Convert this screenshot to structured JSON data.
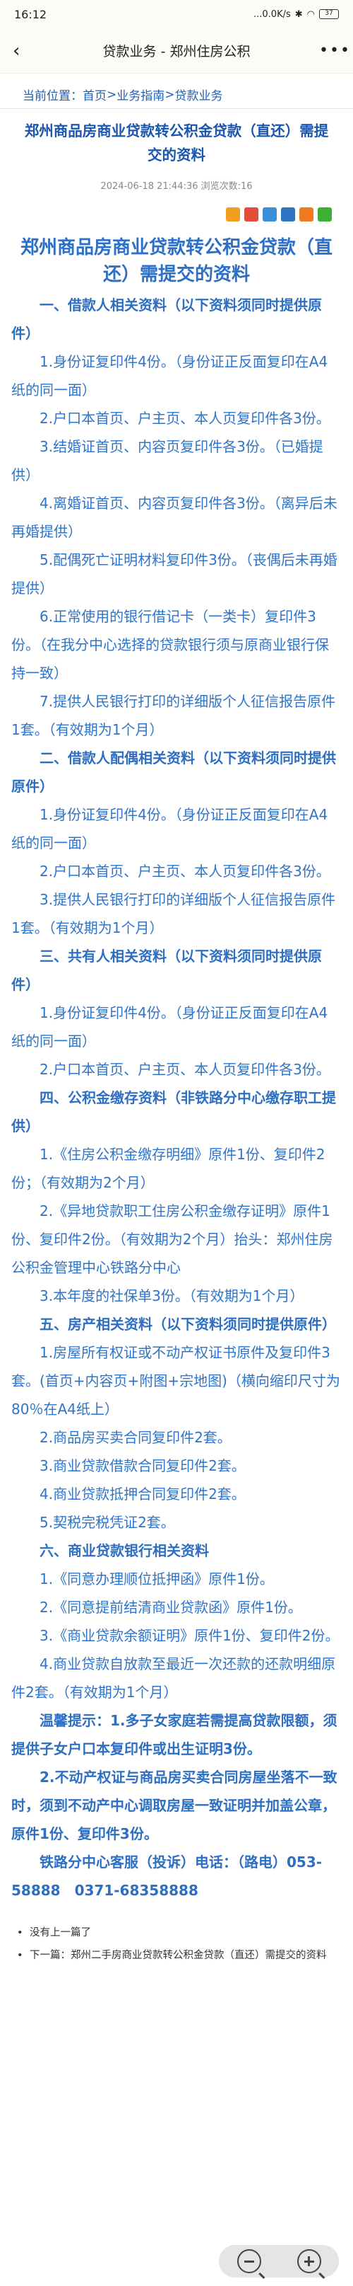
{
  "status": {
    "time": "16:12",
    "network": "...0.0K/s",
    "battery": "37"
  },
  "app_bar": {
    "back_icon": "‹",
    "title": "贷款业务 - 郑州住房公积",
    "more_icon": "•••"
  },
  "breadcrumb": {
    "label": "当前位置：",
    "home": "首页",
    "sep1": ">",
    "level1": "业务指南",
    "sep2": ">",
    "level2": "贷款业务"
  },
  "article": {
    "title": "郑州商品房商业贷款转公积金贷款（直还）需提交的资料",
    "date": "2024-06-18 21:44:36",
    "views": "浏览次数:16"
  },
  "share_icons": [
    {
      "name": "qzone-share-icon",
      "color": "#f0a020"
    },
    {
      "name": "weibo-share-icon",
      "color": "#e34c3b"
    },
    {
      "name": "tencent-weibo-share-icon",
      "color": "#3a8fd6"
    },
    {
      "name": "renren-share-icon",
      "color": "#2f74c5"
    },
    {
      "name": "douban-share-icon",
      "color": "#f07a20"
    },
    {
      "name": "wechat-share-icon",
      "color": "#3cb034"
    }
  ],
  "content": {
    "title": "郑州商品房商业贷款转公积金贷款（直还）需提交的资料",
    "paragraphs": [
      {
        "t": "一、借款人相关资料（以下资料须同时提供原件）",
        "head": true
      },
      {
        "t": "1.身份证复印件4份。（身份证正反面复印在A4纸的同一面）"
      },
      {
        "t": "2.户口本首页、户主页、本人页复印件各3份。"
      },
      {
        "t": "3.结婚证首页、内容页复印件各3份。（已婚提供）"
      },
      {
        "t": "4.离婚证首页、内容页复印件各3份。（离异后未再婚提供）"
      },
      {
        "t": "5.配偶死亡证明材料复印件3份。（丧偶后未再婚提供）"
      },
      {
        "t": "6.正常使用的银行借记卡（一类卡）复印件3份。（在我分中心选择的贷款银行须与原商业银行保持一致）"
      },
      {
        "t": "7.提供人民银行打印的详细版个人征信报告原件1套。（有效期为1个月）"
      },
      {
        "t": "二、借款人配偶相关资料（以下资料须同时提供原件）",
        "head": true
      },
      {
        "t": "1.身份证复印件4份。（身份证正反面复印在A4纸的同一面）"
      },
      {
        "t": "2.户口本首页、户主页、本人页复印件各3份。"
      },
      {
        "t": "3.提供人民银行打印的详细版个人征信报告原件1套。（有效期为1个月）"
      },
      {
        "t": "三、共有人相关资料（以下资料须同时提供原件）",
        "head": true
      },
      {
        "t": "1.身份证复印件4份。（身份证正反面复印在A4纸的同一面）"
      },
      {
        "t": "2.户口本首页、户主页、本人页复印件各3份。"
      },
      {
        "t": "四、公积金缴存资料（非铁路分中心缴存职工提供）",
        "head": true
      },
      {
        "t": "1.《住房公积金缴存明细》原件1份、复印件2份；（有效期为2个月）"
      },
      {
        "t": "2.《异地贷款职工住房公积金缴存证明》原件1份、复印件2份。（有效期为2个月）抬头：郑州住房公积金管理中心铁路分中心"
      },
      {
        "t": "3.本年度的社保单3份。（有效期为1个月）"
      },
      {
        "t": "五、房产相关资料（以下资料须同时提供原件）",
        "head": true
      },
      {
        "t": "1.房屋所有权证或不动产权证书原件及复印件3套。(首页+内容页+附图+宗地图)（横向缩印尺寸为80％在A4纸上）"
      },
      {
        "t": "2.商品房买卖合同复印件2套。"
      },
      {
        "t": "3.商业贷款借款合同复印件2套。"
      },
      {
        "t": "4.商业贷款抵押合同复印件2套。"
      },
      {
        "t": "5.契税完税凭证2套。"
      },
      {
        "t": "六、商业贷款银行相关资料",
        "head": true
      },
      {
        "t": "1.《同意办理顺位抵押函》原件1份。"
      },
      {
        "t": "2.《同意提前结清商业贷款函》原件1份。"
      },
      {
        "t": "3.《商业贷款余额证明》原件1份、复印件2份。"
      },
      {
        "t": "4.商业贷款自放款至最近一次还款的还款明细原件2套。（有效期为1个月）"
      },
      {
        "t": "温馨提示：1.多子女家庭若需提高贷款限额，须提供子女户口本复印件或出生证明3份。",
        "head": true
      },
      {
        "t": "2.不动产权证与商品房买卖合同房屋坐落不一致时，须到不动产中心调取房屋一致证明并加盖公章，原件1份、复印件3份。",
        "head": true
      },
      {
        "t": "铁路分中心客服（投诉）电话：（路电）053-58888　0371-68358888",
        "head": true
      }
    ]
  },
  "pager": {
    "bullet": "•",
    "prev": "没有上一篇了",
    "next": "下一篇：郑州二手房商业贷款转公积金贷款（直还）需提交的资料"
  },
  "zoom": {
    "out_icon": "zoom-out-icon",
    "in_icon": "zoom-in-icon"
  }
}
